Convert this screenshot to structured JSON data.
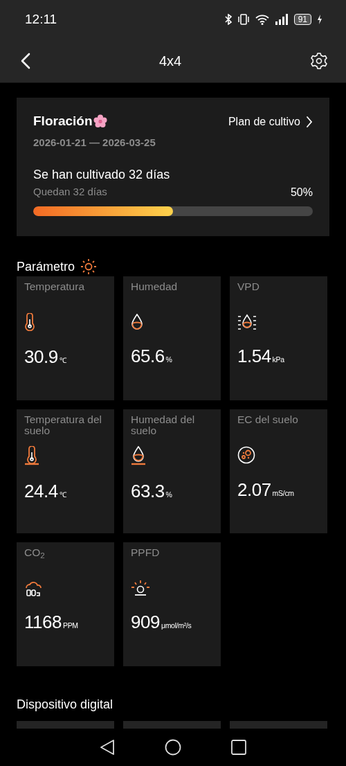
{
  "status_bar": {
    "time": "12:11",
    "battery": "91"
  },
  "header": {
    "title": "4x4"
  },
  "grow_stage": {
    "title": "Floración",
    "dates": "2026-01-21 — 2026-03-25",
    "plan_link": "Plan de cultivo",
    "cultivated": "Se han cultivado 32 días",
    "remaining": "Quedan 32 días",
    "percent": "50%",
    "level": 0.5
  },
  "parameters": {
    "title": "Parámetro",
    "tiles": [
      {
        "kind": "temperature",
        "label": "Temperatura",
        "value": "30.9",
        "unit": "℃"
      },
      {
        "kind": "humidity",
        "label": "Humedad",
        "value": "65.6",
        "unit": "%"
      },
      {
        "kind": "vpd",
        "label": "VPD",
        "value": "1.54",
        "unit": "kPa"
      },
      {
        "kind": "soil_temperature",
        "label": "Temperatura del suelo",
        "value": "24.4",
        "unit": "℃"
      },
      {
        "kind": "soil_humidity",
        "label": "Humedad del suelo",
        "value": "63.3",
        "unit": "%"
      },
      {
        "kind": "soil_ec",
        "label": "EC del suelo",
        "value": "2.07",
        "unit": "mS/cm"
      },
      {
        "kind": "co2",
        "label": "CO$_{2}$",
        "value": "1168",
        "unit": "PPM"
      },
      {
        "kind": "ppfd",
        "label": "PPFD",
        "value": "909",
        "unit": "μmol/m²/s"
      }
    ]
  },
  "digital_devices": {
    "title": "Dispositivo digital"
  }
}
